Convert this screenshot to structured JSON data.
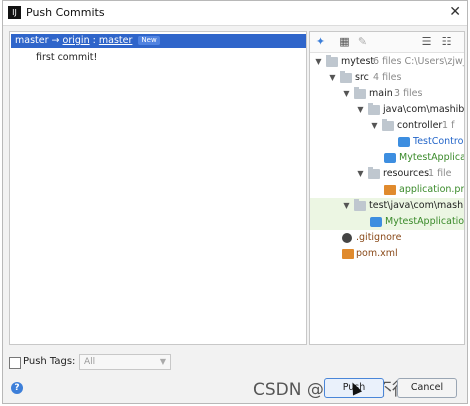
{
  "window": {
    "title": "Push Commits",
    "close_glyph": "✕"
  },
  "commits": {
    "branch_local": "master",
    "arrow": "→",
    "remote": "origin",
    "separator": ":",
    "branch_remote": "master",
    "badge": "New",
    "items": [
      {
        "message": "first commit!"
      }
    ]
  },
  "tree": {
    "toolbar_icons": [
      "pin-icon",
      "group-icon",
      "edit-icon",
      "expand-all-icon",
      "collapse-all-icon"
    ],
    "nodes": [
      {
        "label": "mytest",
        "meta": "6 files  C:\\Users\\zjw_",
        "icon": "folder-icon"
      },
      {
        "label": "src",
        "meta": "4 files",
        "icon": "folder-icon"
      },
      {
        "label": "main",
        "meta": "3 files",
        "icon": "folder-icon"
      },
      {
        "label": "java\\com\\mashib",
        "meta": "",
        "icon": "folder-icon"
      },
      {
        "label": "controller",
        "meta": "1 f",
        "icon": "folder-icon"
      },
      {
        "label": "TestContro",
        "meta": "",
        "icon": "java-class-icon"
      },
      {
        "label": "MytestApplica",
        "meta": "",
        "icon": "java-class-icon"
      },
      {
        "label": "resources",
        "meta": "1 file",
        "icon": "folder-icon"
      },
      {
        "label": "application.pr",
        "meta": "",
        "icon": "properties-file-icon"
      },
      {
        "label": "test\\java\\com\\mashi",
        "meta": "",
        "icon": "folder-icon"
      },
      {
        "label": "MytestApplicatio",
        "meta": "",
        "icon": "java-class-icon"
      },
      {
        "label": ".gitignore",
        "meta": "",
        "icon": "gitignore-icon"
      },
      {
        "label": "pom.xml",
        "meta": "",
        "icon": "xml-file-icon"
      }
    ]
  },
  "footer": {
    "push_tags_label": "Push Tags:",
    "tags_select_value": "All",
    "help_glyph": "?",
    "push_button": "Push",
    "cancel_button": "Cancel",
    "watermark": "CSDN @一切水不行吗"
  },
  "colors": {
    "selection": "#2f65ca",
    "accent": "#3d7fd9"
  }
}
